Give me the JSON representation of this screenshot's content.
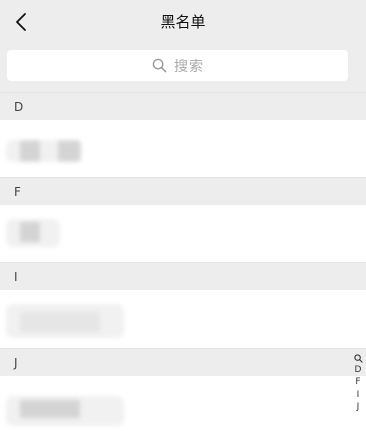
{
  "header": {
    "title": "黑名单",
    "back_icon": "chevron-left-icon"
  },
  "search": {
    "placeholder": "搜索",
    "icon": "search-icon"
  },
  "sections": [
    {
      "letter": "D",
      "contacts": [
        {
          "name_redacted": true
        }
      ]
    },
    {
      "letter": "F",
      "contacts": [
        {
          "name_redacted": true
        }
      ]
    },
    {
      "letter": "I",
      "contacts": [
        {
          "name_redacted": true
        }
      ]
    },
    {
      "letter": "J",
      "contacts": [
        {
          "name_redacted": true
        }
      ]
    }
  ],
  "index_bar": {
    "search_icon": "search-icon",
    "letters": [
      "D",
      "F",
      "I",
      "J"
    ]
  },
  "colors": {
    "header_bg": "#ededed",
    "row_bg": "#ffffff",
    "placeholder": "#a9a9a9"
  }
}
